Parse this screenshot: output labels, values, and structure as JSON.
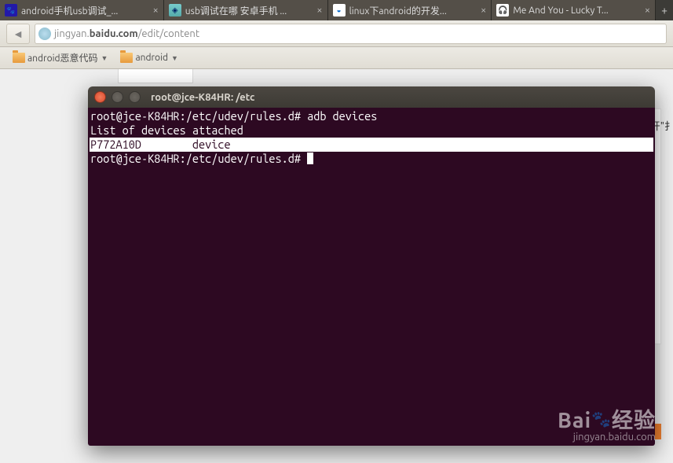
{
  "tabs": [
    {
      "title": "android手机usb调试_...",
      "icon": "paw"
    },
    {
      "title": "usb调试在哪 安卓手机 ...",
      "icon": "diamond"
    },
    {
      "title": "linux下android的开发...",
      "icon": "globe"
    },
    {
      "title": "Me And You - Lucky T...",
      "icon": "head"
    }
  ],
  "url": {
    "prefix": "jingyan.",
    "bold": "baidu.com",
    "suffix": "/edit/content"
  },
  "bookmarks": [
    {
      "label": "android恶意代码"
    },
    {
      "label": "android"
    }
  ],
  "page_cutoff_text": "开\"扌",
  "terminal": {
    "title": "root@jce-K84HR: /etc",
    "lines": [
      {
        "text": "root@jce-K84HR:/etc/udev/rules.d# adb devices",
        "hl": false
      },
      {
        "text": "List of devices attached ",
        "hl": false
      },
      {
        "text": "P772A10D        device                                                         ",
        "hl": true
      },
      {
        "text": "",
        "hl": false
      },
      {
        "text": "root@jce-K84HR:/etc/udev/rules.d# ",
        "hl": false,
        "cursor": true
      }
    ]
  },
  "watermark": {
    "main1": "Bai",
    "main2": "经验",
    "sub": "jingyan.baidu.com"
  }
}
